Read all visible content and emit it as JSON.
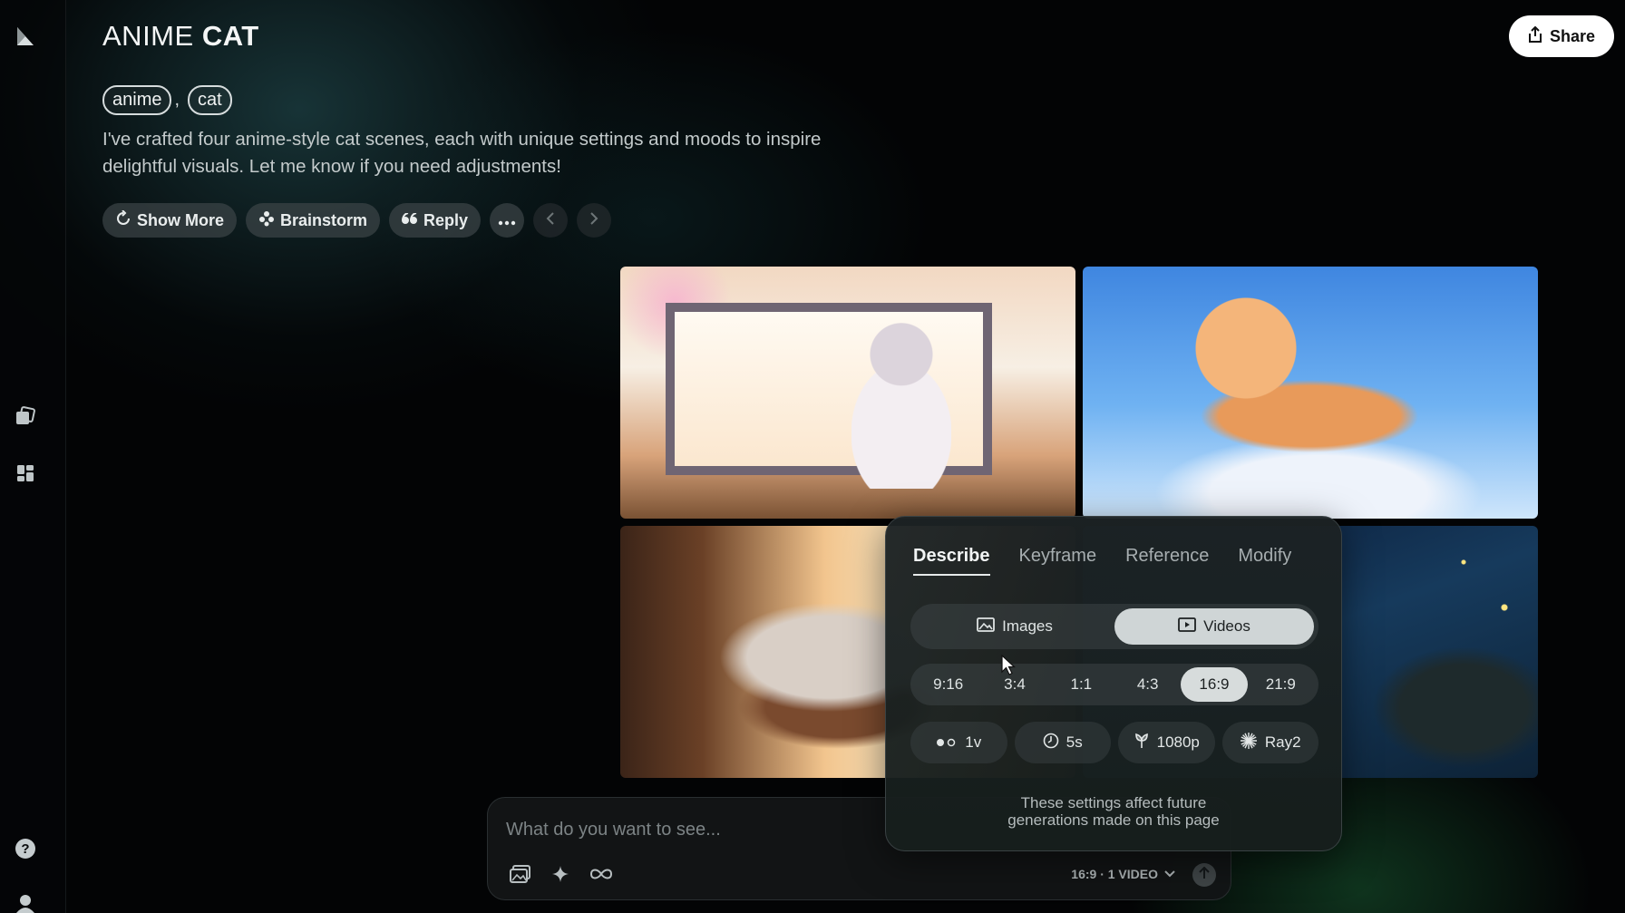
{
  "header": {
    "title_light": "ANIME",
    "title_bold": "CAT",
    "share_label": "Share"
  },
  "tags": [
    "anime",
    "cat"
  ],
  "tag_separator": ",",
  "description": "I've crafted four anime-style cat scenes, each with unique settings and moods to inspire delightful visuals. Let me know if you need adjustments!",
  "actions": {
    "show_more": "Show More",
    "brainstorm": "Brainstorm",
    "reply": "Reply"
  },
  "composer": {
    "placeholder": "What do you want to see...",
    "settings_summary": "16:9 · 1 VIDEO"
  },
  "settings_panel": {
    "tabs": [
      "Describe",
      "Keyframe",
      "Reference",
      "Modify"
    ],
    "active_tab": "Describe",
    "media_types": [
      "Images",
      "Videos"
    ],
    "selected_media": "Videos",
    "aspect_ratios": [
      "9:16",
      "3:4",
      "1:1",
      "4:3",
      "16:9",
      "21:9"
    ],
    "selected_ratio": "16:9",
    "options": {
      "count": "1v",
      "duration": "5s",
      "resolution": "1080p",
      "model": "Ray2"
    },
    "note_line1": "These settings affect future",
    "note_line2": "generations made on this page"
  },
  "icons": {
    "logo": "luma-logo-icon",
    "share": "share-icon",
    "show_more": "refresh-icon",
    "brainstorm": "brainstorm-icon",
    "reply": "quote-icon",
    "more": "more-icon",
    "prev": "chevron-left-icon",
    "next": "chevron-right-icon"
  },
  "colors": {
    "background": "#030405",
    "accent_glow": "#285a5f",
    "selected_segment": "#d7dcdc"
  }
}
